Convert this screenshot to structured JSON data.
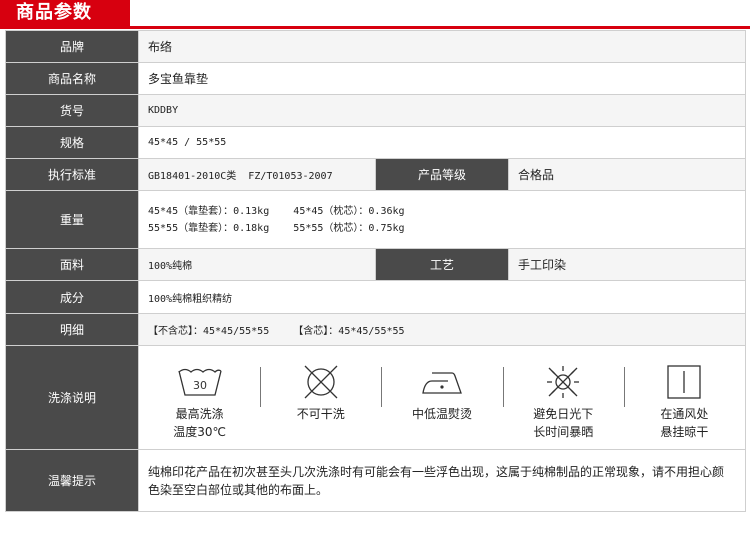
{
  "header": {
    "title": "商品参数"
  },
  "rows": {
    "brand": {
      "label": "品牌",
      "value": "布络"
    },
    "name": {
      "label": "商品名称",
      "value": "多宝鱼靠垫"
    },
    "sku": {
      "label": "货号",
      "value": "KDDBY"
    },
    "spec": {
      "label": "规格",
      "value": "45*45 / 55*55"
    },
    "standard": {
      "label": "执行标准",
      "value": "GB18401-2010C类  FZ/T01053-2007",
      "grade_label": "产品等级",
      "grade_value": "合格品"
    },
    "weight": {
      "label": "重量",
      "line1": "45*45（靠垫套）：0.13kg    45*45（枕芯）：0.36kg",
      "line2": "55*55（靠垫套）：0.18kg    55*55（枕芯）：0.75kg"
    },
    "fabric": {
      "label": "面料",
      "value": "100%纯棉",
      "craft_label": "工艺",
      "craft_value": "手工印染"
    },
    "composition": {
      "label": "成分",
      "value": "100%纯棉粗织精纺"
    },
    "detail": {
      "label": "明细",
      "value": "【不含芯】：45*45/55*55    【含芯】：45*45/55*55"
    },
    "care": {
      "label": "洗涤说明",
      "items": [
        {
          "icon": "wash-30-icon",
          "number": "30",
          "line1": "最高洗涤",
          "line2": "温度30℃"
        },
        {
          "icon": "no-dry-clean-icon",
          "line1": "不可干洗",
          "line2": ""
        },
        {
          "icon": "iron-low-icon",
          "line1": "中低温熨烫",
          "line2": ""
        },
        {
          "icon": "no-sun-icon",
          "line1": "避免日光下",
          "line2": "长时间暴晒"
        },
        {
          "icon": "hang-dry-shade-icon",
          "line1": "在通风处",
          "line2": "悬挂晾干"
        }
      ]
    },
    "tips": {
      "label": "温馨提示",
      "value": "纯棉印花产品在初次甚至头几次洗涤时有可能会有一些浮色出现，这属于纯棉制品的正常现象，请不用担心颜色染至空白部位或其他的布面上。"
    }
  }
}
